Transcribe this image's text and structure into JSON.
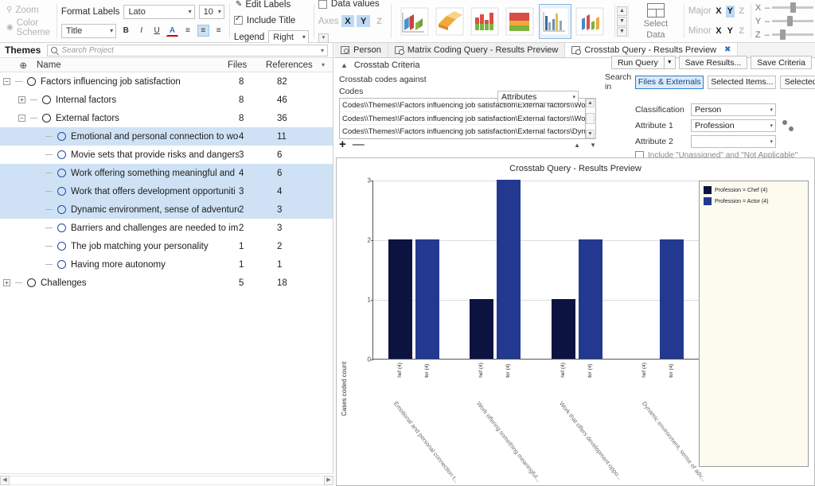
{
  "ribbon": {
    "zoom_label": "Zoom",
    "colorscheme_label": "Color Scheme",
    "format_labels_label": "Format Labels",
    "font_name": "Lato",
    "font_size": "10",
    "label_target": "Title",
    "bold": "B",
    "italic": "I",
    "underline": "U",
    "font_color": "A",
    "align_left": "≡",
    "align_center": "≡",
    "align_right": "≡",
    "edit_labels_label": "Edit Labels",
    "include_title_label": "Include Title",
    "include_title_checked": true,
    "legend_label": "Legend",
    "legend_value": "Right",
    "data_values_label": "Data values",
    "data_values_checked": false,
    "axes_label": "Axes",
    "axes_x": "X",
    "axes_y": "Y",
    "axes_z": "Z",
    "select_data_label_1": "Select",
    "select_data_label_2": "Data",
    "major_label": "Major",
    "minor_label": "Minor",
    "gridline_x": "X",
    "gridline_y": "Y",
    "gridline_z": "Z",
    "slider_x": "X",
    "slider_y": "Y",
    "slider_z": "Z",
    "minus": "–",
    "plus": "+",
    "scroll_up": "▲",
    "scroll_down": "▼",
    "scroll_more": "▼"
  },
  "left_panel": {
    "title": "Themes",
    "search_placeholder": "Search Project",
    "columns": {
      "name": "Name",
      "files": "Files",
      "references": "References"
    },
    "rows": [
      {
        "label": "Factors influencing job satisfaction",
        "files": "8",
        "references": "82",
        "level": 0,
        "expander": "−",
        "highlight": false
      },
      {
        "label": "Internal factors",
        "files": "8",
        "references": "46",
        "level": 1,
        "expander": "+",
        "highlight": false
      },
      {
        "label": "External factors",
        "files": "8",
        "references": "36",
        "level": 1,
        "expander": "−",
        "highlight": false
      },
      {
        "label": "Emotional and personal connection to wor",
        "files": "4",
        "references": "11",
        "level": 2,
        "expander": "",
        "highlight": true
      },
      {
        "label": "Movie sets that provide risks and dangers",
        "files": "3",
        "references": "6",
        "level": 2,
        "expander": "",
        "highlight": false
      },
      {
        "label": "Work offering something meaningful and",
        "files": "4",
        "references": "6",
        "level": 2,
        "expander": "",
        "highlight": true
      },
      {
        "label": "Work that offers development opportuniti",
        "files": "3",
        "references": "4",
        "level": 2,
        "expander": "",
        "highlight": true
      },
      {
        "label": "Dynamic environment, sense of adventure",
        "files": "2",
        "references": "3",
        "level": 2,
        "expander": "",
        "highlight": true
      },
      {
        "label": "Barriers and challenges are needed to imp",
        "files": "2",
        "references": "3",
        "level": 2,
        "expander": "",
        "highlight": false
      },
      {
        "label": "The job matching your personality",
        "files": "1",
        "references": "2",
        "level": 2,
        "expander": "",
        "highlight": false
      },
      {
        "label": "Having more autonomy",
        "files": "1",
        "references": "1",
        "level": 2,
        "expander": "",
        "highlight": false
      },
      {
        "label": "Challenges",
        "files": "5",
        "references": "18",
        "level": 0,
        "expander": "+",
        "highlight": false
      }
    ]
  },
  "tabs": [
    {
      "label": "Person",
      "icon": "person-icon",
      "active": false,
      "closable": false
    },
    {
      "label": "Matrix Coding Query - Results Preview",
      "icon": "query-icon",
      "active": false,
      "closable": false
    },
    {
      "label": "Crosstab Query - Results Preview",
      "icon": "query-icon",
      "active": true,
      "closable": true,
      "close": "✖"
    }
  ],
  "criteria": {
    "section_title": "Crosstab Criteria",
    "codes_against_label": "Crosstab codes against",
    "codes_against_value": "Attributes",
    "codes_label": "Codes",
    "code_lines": [
      "Codes\\\\Themes\\\\Factors influencing job satisfaction\\External factors\\\\Work offering somethi",
      "Codes\\\\Themes\\\\Factors influencing job satisfaction\\External factors\\\\Work that offers devel",
      "Codes\\\\Themes\\\\Factors influencing job satisfaction\\External factors\\Dynamic environment,"
    ],
    "add_button": "+",
    "remove_button": "—",
    "move_up": "▲",
    "move_down": "▼",
    "run_query": "Run Query",
    "run_query_arrow": "▼",
    "save_results": "Save Results...",
    "save_criteria": "Save Criteria",
    "search_in_label": "Search in",
    "search_in_selected": "Files & Externals",
    "selected_items": "Selected Items...",
    "selected_folders": "Selected Fol...",
    "classification_label": "Classification",
    "classification_value": "Person",
    "attribute1_label": "Attribute 1",
    "attribute1_value": "Profession",
    "attribute2_label": "Attribute 2",
    "attribute2_value": "",
    "unassigned_label": "Include \"Unassigned\" and \"Not Applicable\"",
    "unassigned_checked": false
  },
  "chart_data": {
    "type": "bar",
    "title": "Crosstab Query - Results Preview",
    "xlabel": "",
    "ylabel": "Cases coded count",
    "ylim": [
      0,
      3
    ],
    "yticks": [
      "0",
      "1",
      "2",
      "3"
    ],
    "grid": true,
    "legend_position": "right",
    "categories": [
      "Emotional and personal connection t...",
      "Work offering something meaningful...",
      "Work that offers development oppo...",
      "Dynamic environment, sense of adv..."
    ],
    "series": [
      {
        "name": "Profession = Chef (4)",
        "color": "#0d1340",
        "values": [
          2,
          1,
          1,
          0
        ],
        "tick_label": "hef (4)"
      },
      {
        "name": "Profession = Actor (4)",
        "color": "#22398f",
        "values": [
          2,
          3,
          2,
          2
        ],
        "tick_label": "tor (4)"
      }
    ]
  }
}
